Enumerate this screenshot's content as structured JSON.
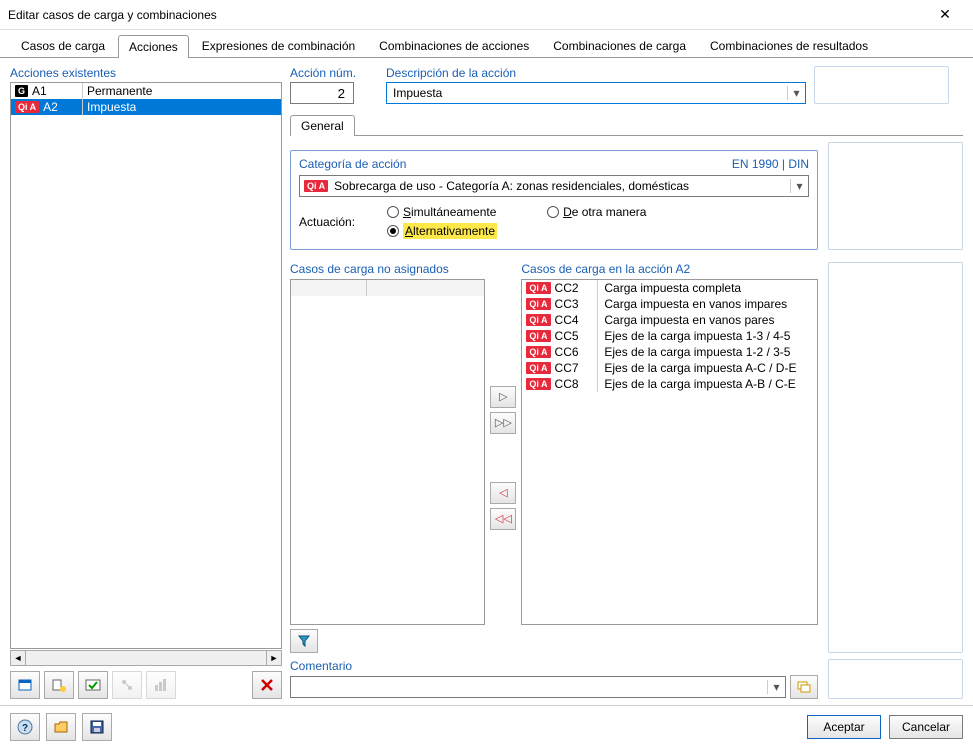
{
  "window": {
    "title": "Editar casos de carga y combinaciones"
  },
  "tabs": {
    "items": [
      "Casos de carga",
      "Acciones",
      "Expresiones de combinación",
      "Combinaciones de acciones",
      "Combinaciones de carga",
      "Combinaciones de resultados"
    ],
    "active": 1
  },
  "existing": {
    "label": "Acciones existentes",
    "rows": [
      {
        "badge": "G",
        "badgeClass": "badge-g",
        "code": "A1",
        "desc": "Permanente",
        "selected": false
      },
      {
        "badge": "Qi A",
        "badgeClass": "badge-qi",
        "code": "A2",
        "desc": "Impuesta",
        "selected": true
      }
    ]
  },
  "action": {
    "num_label": "Acción núm.",
    "num_value": "2",
    "desc_label": "Descripción de la acción",
    "desc_value": "Impuesta"
  },
  "subTabs": {
    "items": [
      "General"
    ],
    "active": 0
  },
  "category": {
    "label": "Categoría de acción",
    "norm": "EN 1990 | DIN",
    "badge": "Qi A",
    "value": "Sobrecarga de uso - Categoría A: zonas residenciales, domésticas"
  },
  "behavior": {
    "label": "Actuación:",
    "opts": {
      "sim": {
        "u": "S",
        "rest": "imultáneamente"
      },
      "alt": {
        "u": "A",
        "rest": "lternativamente"
      },
      "otr": {
        "u": "D",
        "rest": "e otra manera"
      }
    },
    "selected": "alt"
  },
  "unassigned": {
    "label": "Casos de carga no asignados"
  },
  "assigned": {
    "label": "Casos de carga en la acción A2",
    "rows": [
      {
        "badge": "Qi A",
        "code": "CC2",
        "desc": "Carga impuesta completa"
      },
      {
        "badge": "Qi A",
        "code": "CC3",
        "desc": "Carga impuesta en vanos impares"
      },
      {
        "badge": "Qi A",
        "code": "CC4",
        "desc": "Carga impuesta en vanos pares"
      },
      {
        "badge": "Qi A",
        "code": "CC5",
        "desc": "Ejes de la carga impuesta 1-3 / 4-5"
      },
      {
        "badge": "Qi A",
        "code": "CC6",
        "desc": "Ejes de la carga impuesta 1-2 / 3-5"
      },
      {
        "badge": "Qi A",
        "code": "CC7",
        "desc": "Ejes de la carga impuesta A-C / D-E"
      },
      {
        "badge": "Qi A",
        "code": "CC8",
        "desc": "Ejes de la carga impuesta A-B / C-E"
      }
    ]
  },
  "comment": {
    "label": "Comentario",
    "value": ""
  },
  "footer": {
    "ok": "Aceptar",
    "cancel": "Cancelar"
  }
}
